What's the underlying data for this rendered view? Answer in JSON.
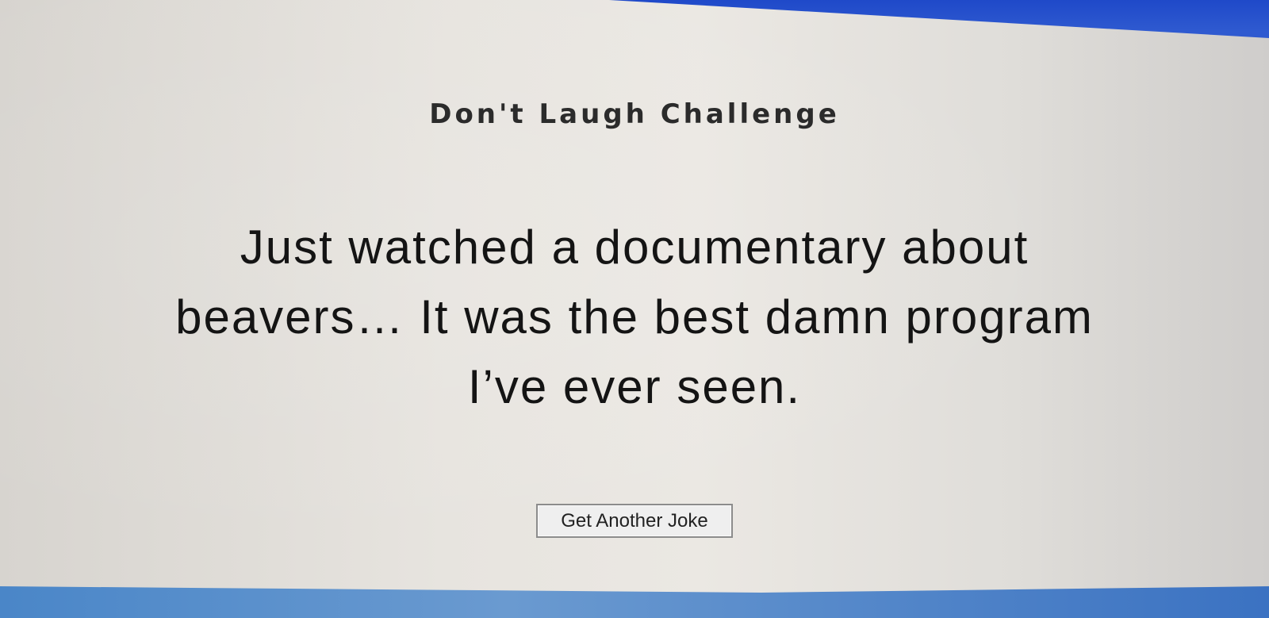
{
  "header": {
    "title": "Don't Laugh Challenge"
  },
  "joke": {
    "text": "Just watched a documentary about beavers… It was the best damn program I’ve ever seen."
  },
  "actions": {
    "get_another_joke_label": "Get Another Joke"
  },
  "colors": {
    "page_background": "#e6e3de",
    "frame_blue": "#2f5ad0",
    "text": "#141414"
  }
}
